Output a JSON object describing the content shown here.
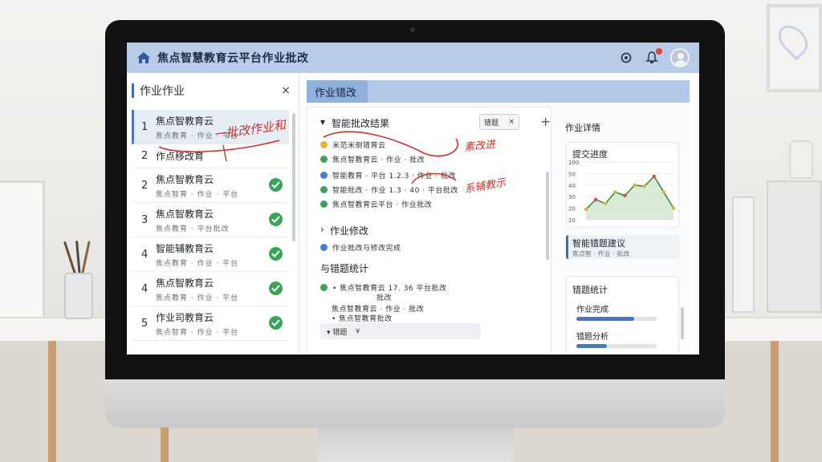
{
  "app": {
    "title": "焦点智慧教育云平台作业批改"
  },
  "left_panel": {
    "title": "作业作业",
    "close": "×",
    "items": [
      {
        "num": "1",
        "name": "焦点智教育云",
        "sub": "焦点教育 · 作业 · 平台",
        "status": "active"
      },
      {
        "num": "2",
        "name": "作点移改育",
        "sub": "",
        "status": "plain"
      },
      {
        "num": "2",
        "name": "焦点智教育云",
        "sub": "焦点智育 · 作业 · 平台",
        "status": "done"
      },
      {
        "num": "3",
        "name": "焦点智教育云",
        "sub": "焦点教育 · 平台批改",
        "status": "done"
      },
      {
        "num": "4",
        "name": "智能辅教育云",
        "sub": "焦点教育 · 作业 · 平台",
        "status": "done"
      },
      {
        "num": "4",
        "name": "焦点智教育云",
        "sub": "焦点教育 · 作业 · 平台",
        "status": "done"
      },
      {
        "num": "5",
        "name": "作业司教育云",
        "sub": "焦点智育 · 作业 · 平台",
        "status": "done"
      }
    ]
  },
  "annotations": {
    "a1": "一批改作业和",
    "a2": "素改进",
    "a3": "系辅教示"
  },
  "mid_panel": {
    "tab": "作业错改",
    "section1": "智能批改结果",
    "tag": "错题",
    "tag_close": "×",
    "plus": "+",
    "rows": [
      {
        "color": "yellow",
        "text": "米范米侧错育云"
      },
      {
        "color": "green",
        "text": "焦点智教育云 · 作业 · 批改"
      },
      {
        "color": "blue",
        "text": "智能教育 · 平台 1.2.3 · 作业 · 批改"
      },
      {
        "color": "green",
        "text": "智能批改 · 作业 1.3 · 40 · 平台批改"
      },
      {
        "color": "green",
        "text": "焦点智教育云平台 · 作业批改"
      }
    ],
    "section2": "作业修改",
    "row2": "作业批改与修改完成",
    "section3": "与错题统计",
    "stat1": "• 焦点智教育云 17. 36 平台批改",
    "stat1b": "批改",
    "stat2": "焦点智教育云 · 作业 · 批改",
    "stat3": "• 焦点智教育批改",
    "pill_a": "▾ 错题",
    "pill_b": "∨"
  },
  "right_panel": {
    "title": "作业详情",
    "chart_title": "提交进度",
    "chart_data": {
      "type": "line",
      "y_ticks": [
        "100",
        "50",
        "40",
        "30",
        "20",
        "10"
      ],
      "values": [
        18,
        35,
        28,
        48,
        42,
        60,
        58,
        75,
        48,
        20
      ],
      "color": "#3f8a3c",
      "fill": "#cfe5cc"
    },
    "suggest_title": "智能错题建议",
    "suggest_sub": "焦点智 · 作业 · 批改",
    "stats_title": "错题统计",
    "bar1_label": "作业完成",
    "bar1_value": 0.72,
    "bar2_label": "错题分析",
    "bar2_value": 0.38
  },
  "colors": {
    "header": "#b8cce8",
    "accent": "#3d6fb6",
    "success": "#3aa55a",
    "annotation": "#c8342d"
  }
}
